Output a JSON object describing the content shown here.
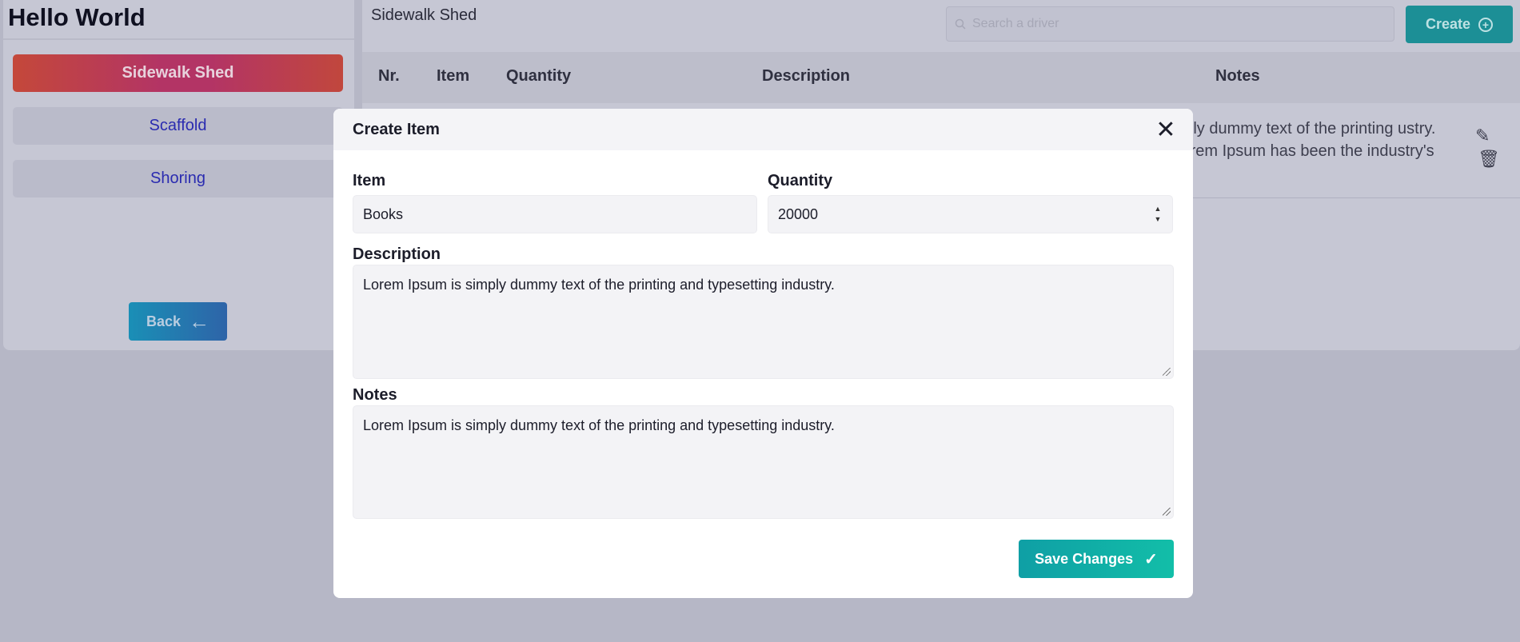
{
  "app": {
    "title": "Hello World"
  },
  "sidebar": {
    "items": [
      {
        "label": "Sidewalk Shed",
        "active": true
      },
      {
        "label": "Scaffold",
        "active": false
      },
      {
        "label": "Shoring",
        "active": false
      }
    ],
    "back_label": "Back"
  },
  "main": {
    "title": "Sidewalk Shed",
    "search_placeholder": "Search a driver",
    "create_label": "Create",
    "table": {
      "columns": [
        "Nr.",
        "Item",
        "Quantity",
        "Description",
        "Notes"
      ],
      "rows": [
        {
          "notes_visible": "mply dummy text of the printing ustry. Lorem Ipsum has been the industry's"
        }
      ]
    }
  },
  "modal": {
    "title": "Create Item",
    "item_label": "Item",
    "item_value": "Books",
    "quantity_label": "Quantity",
    "quantity_value": "20000",
    "description_label": "Description",
    "description_value": "Lorem Ipsum is simply dummy text of the printing and typesetting industry.",
    "notes_label": "Notes",
    "notes_value": "Lorem Ipsum is simply dummy text of the printing and typesetting industry.",
    "save_label": "Save Changes"
  },
  "colors": {
    "accent": "#12bea8",
    "active_nav_start": "#c4483a",
    "active_nav_mid": "#b33465",
    "link": "#2a2bb0",
    "overlay_bg": "#b6b7c6"
  },
  "icons": [
    "search-icon",
    "plus-circle-icon",
    "back-arrow-icon",
    "close-icon",
    "edit-icon",
    "trash-icon",
    "check-icon",
    "stepper-icon"
  ]
}
